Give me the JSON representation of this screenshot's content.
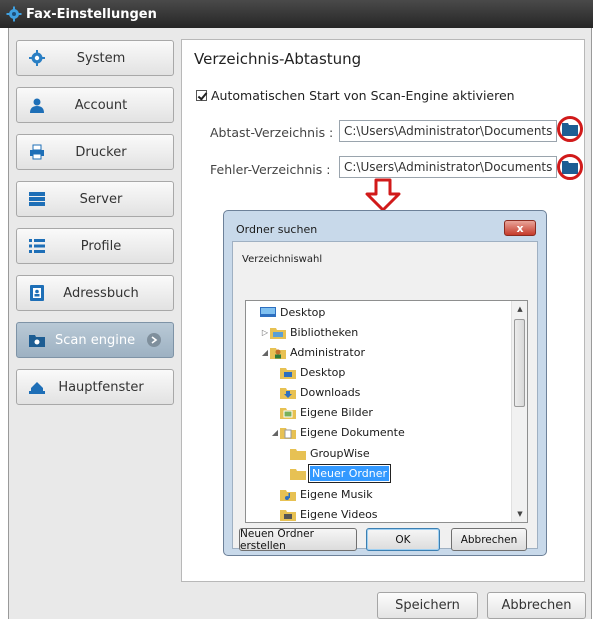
{
  "window": {
    "title": "Fax-Einstellungen"
  },
  "sidebar": {
    "items": [
      {
        "label": "System",
        "icon": "gear-icon"
      },
      {
        "label": "Account",
        "icon": "user-icon"
      },
      {
        "label": "Drucker",
        "icon": "printer-icon"
      },
      {
        "label": "Server",
        "icon": "server-icon"
      },
      {
        "label": "Profile",
        "icon": "list-icon"
      },
      {
        "label": "Adressbuch",
        "icon": "addressbook-icon"
      },
      {
        "label": "Scan engine",
        "icon": "scanner-icon",
        "active": true
      },
      {
        "label": "Hauptfenster",
        "icon": "window-icon"
      }
    ]
  },
  "main": {
    "title": "Verzeichnis-Abtastung",
    "autostart_label": "Automatischen Start von Scan-Engine aktivieren",
    "autostart_checked": true,
    "scan_dir_label": "Abtast-Verzeichnis :",
    "scan_dir_value": "C:\\Users\\Administrator\\Documents",
    "error_dir_label": "Fehler-Verzeichnis :",
    "error_dir_value": "C:\\Users\\Administrator\\Documents",
    "save_label": "Speichern",
    "cancel_label": "Abbrechen"
  },
  "dialog": {
    "title": "Ordner suchen",
    "close_label": "x",
    "subtitle": "Verzeichniswahl",
    "tree": [
      {
        "label": "Desktop",
        "indent": 0,
        "twisty": "",
        "icon": "desktop"
      },
      {
        "label": "Bibliotheken",
        "indent": 1,
        "twisty": "▷",
        "icon": "library"
      },
      {
        "label": "Administrator",
        "indent": 1,
        "twisty": "◢",
        "icon": "user"
      },
      {
        "label": "Desktop",
        "indent": 2,
        "twisty": "",
        "icon": "desktop-folder"
      },
      {
        "label": "Downloads",
        "indent": 2,
        "twisty": "",
        "icon": "downloads"
      },
      {
        "label": "Eigene Bilder",
        "indent": 2,
        "twisty": "",
        "icon": "pictures"
      },
      {
        "label": "Eigene Dokumente",
        "indent": 2,
        "twisty": "◢",
        "icon": "documents"
      },
      {
        "label": "GroupWise",
        "indent": 3,
        "twisty": "",
        "icon": "folder"
      },
      {
        "label": "Neuer Ordner",
        "indent": 3,
        "twisty": "",
        "icon": "folder",
        "selected": true
      },
      {
        "label": "Eigene Musik",
        "indent": 2,
        "twisty": "",
        "icon": "music"
      },
      {
        "label": "Eigene Videos",
        "indent": 2,
        "twisty": "",
        "icon": "videos"
      }
    ],
    "new_folder_label": "Neuen Ordner erstellen",
    "ok_label": "OK",
    "cancel_label": "Abbrechen"
  },
  "colors": {
    "annotation_red": "#d11a1a",
    "active_nav": "#9db1c2",
    "selection": "#3399ff"
  }
}
